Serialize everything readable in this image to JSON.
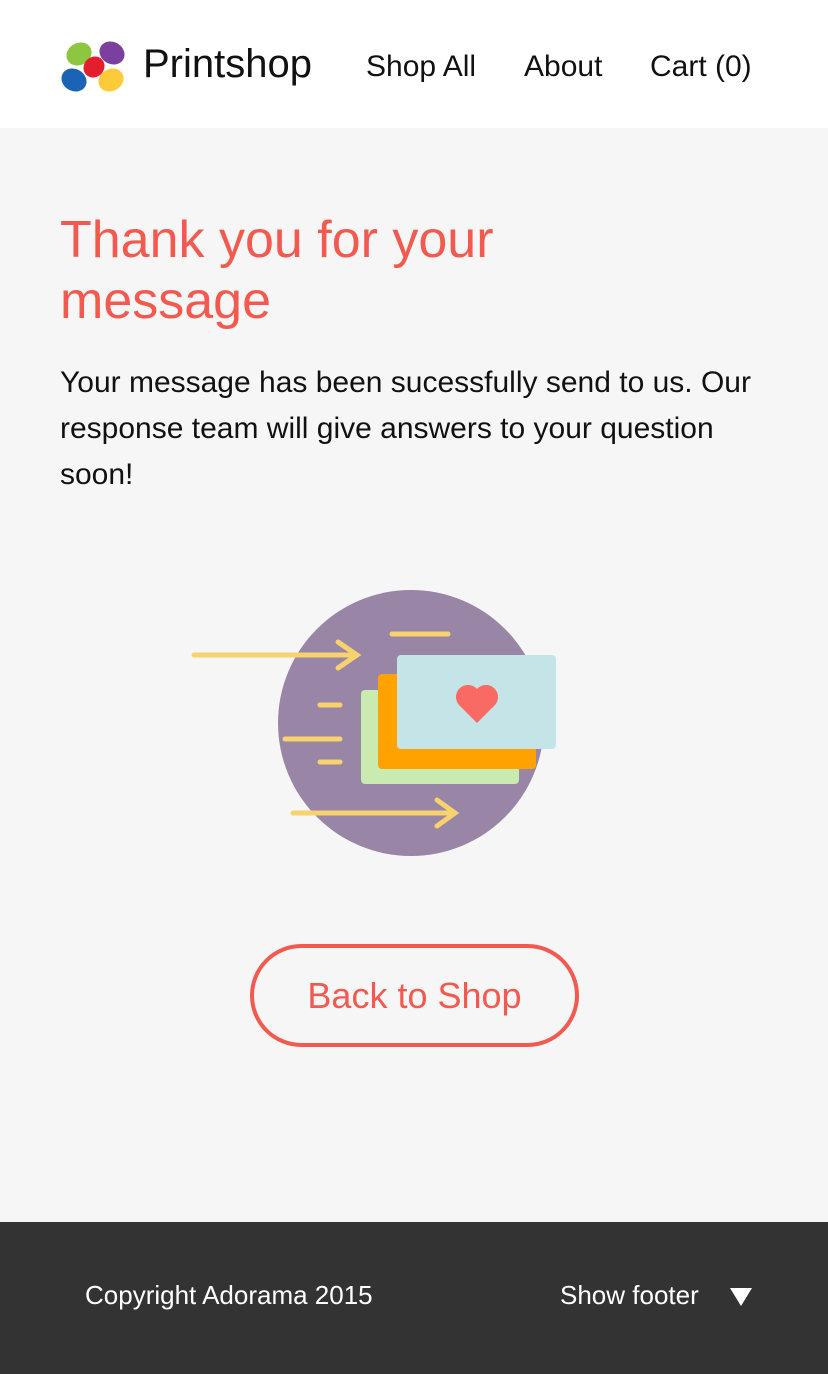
{
  "header": {
    "brand": "Printshop",
    "nav": [
      {
        "label": "Shop All"
      },
      {
        "label": "About"
      },
      {
        "label": "Cart (0)"
      }
    ]
  },
  "main": {
    "title": "Thank you for your message",
    "message": "Your message has been sucessfully send to us. Our response team will give answers to your question soon!",
    "button": "Back to Shop"
  },
  "illustration": {
    "icon": "message-sent-illustration",
    "colors": {
      "circle": "#9985a6",
      "arrows": "#f8d26e",
      "card_back": "#c9ebb0",
      "card_mid": "#ffa200",
      "card_front": "#c5e4e8",
      "heart": "#f96a64"
    }
  },
  "footer": {
    "copyright": "Copyright Adorama 2015",
    "toggle": "Show footer",
    "toggle_icon": "triangle-down-icon"
  },
  "colors": {
    "accent": "#f25a50",
    "footer_bg": "#333333"
  }
}
